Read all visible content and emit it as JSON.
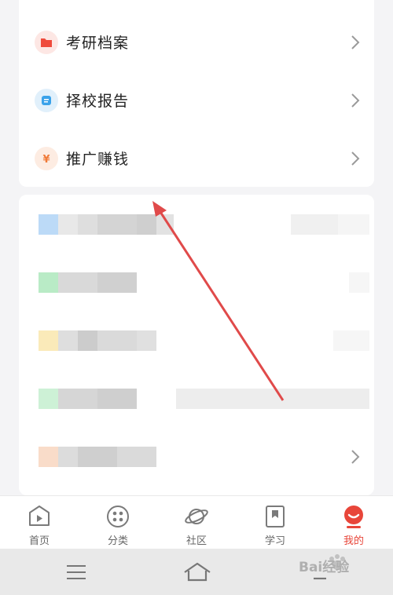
{
  "menu": {
    "items": [
      {
        "label": "考研档案",
        "icon": "folder-icon",
        "color": "#ef4b3c"
      },
      {
        "label": "择校报告",
        "icon": "report-icon",
        "color": "#3aa2ea"
      },
      {
        "label": "推广赚钱",
        "icon": "yen-icon",
        "color": "#f07a38"
      }
    ]
  },
  "tabbar": {
    "tabs": [
      {
        "label": "首页",
        "icon": "home-play-icon"
      },
      {
        "label": "分类",
        "icon": "category-icon"
      },
      {
        "label": "社区",
        "icon": "planet-icon"
      },
      {
        "label": "学习",
        "icon": "bookmark-icon"
      },
      {
        "label": "我的",
        "icon": "profile-icon",
        "active": true
      }
    ]
  },
  "watermark": {
    "text": "Bai经验"
  },
  "colors": {
    "accent": "#e8463a",
    "background": "#f4f4f6"
  }
}
